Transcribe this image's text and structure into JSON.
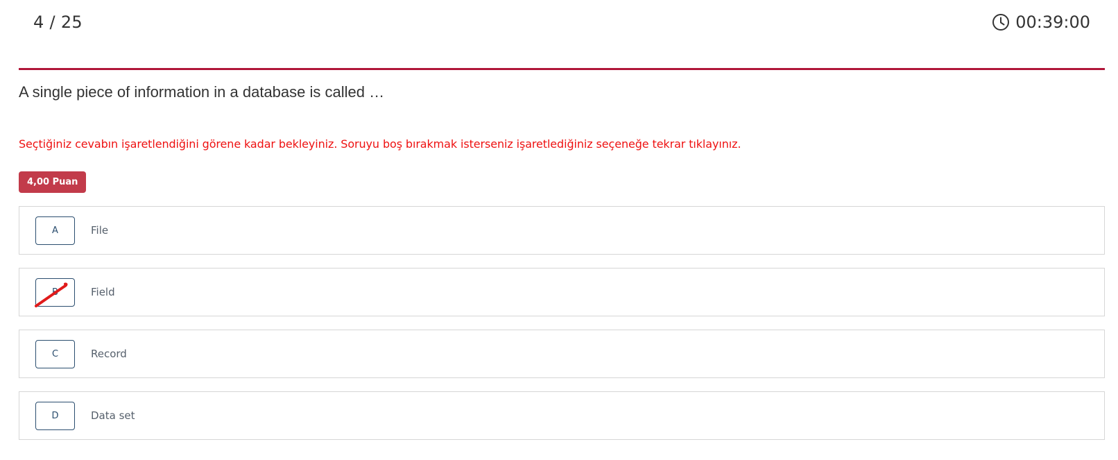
{
  "header": {
    "counter": "4 / 25",
    "timer": "00:39:00",
    "timer_icon": "clock-icon"
  },
  "question": {
    "text": "A single piece of information in a database is called …",
    "instruction": "Seçtiğiniz cevabın işaretlendiğini görene kadar bekleyiniz. Soruyu boş bırakmak isterseniz işaretlediğiniz seçeneğe tekrar tıklayınız.",
    "points": "4,00 Puan"
  },
  "options": [
    {
      "letter": "A",
      "text": "File",
      "struck": false
    },
    {
      "letter": "B",
      "text": "Field",
      "struck": true
    },
    {
      "letter": "C",
      "text": "Record",
      "struck": false
    },
    {
      "letter": "D",
      "text": "Data set",
      "struck": false
    }
  ],
  "colors": {
    "accent": "#b0163a",
    "instruction": "#ee1111",
    "badge": "#c23b4a",
    "letter_box": "#2a4d6e",
    "strike_mark": "#e01b1b"
  }
}
